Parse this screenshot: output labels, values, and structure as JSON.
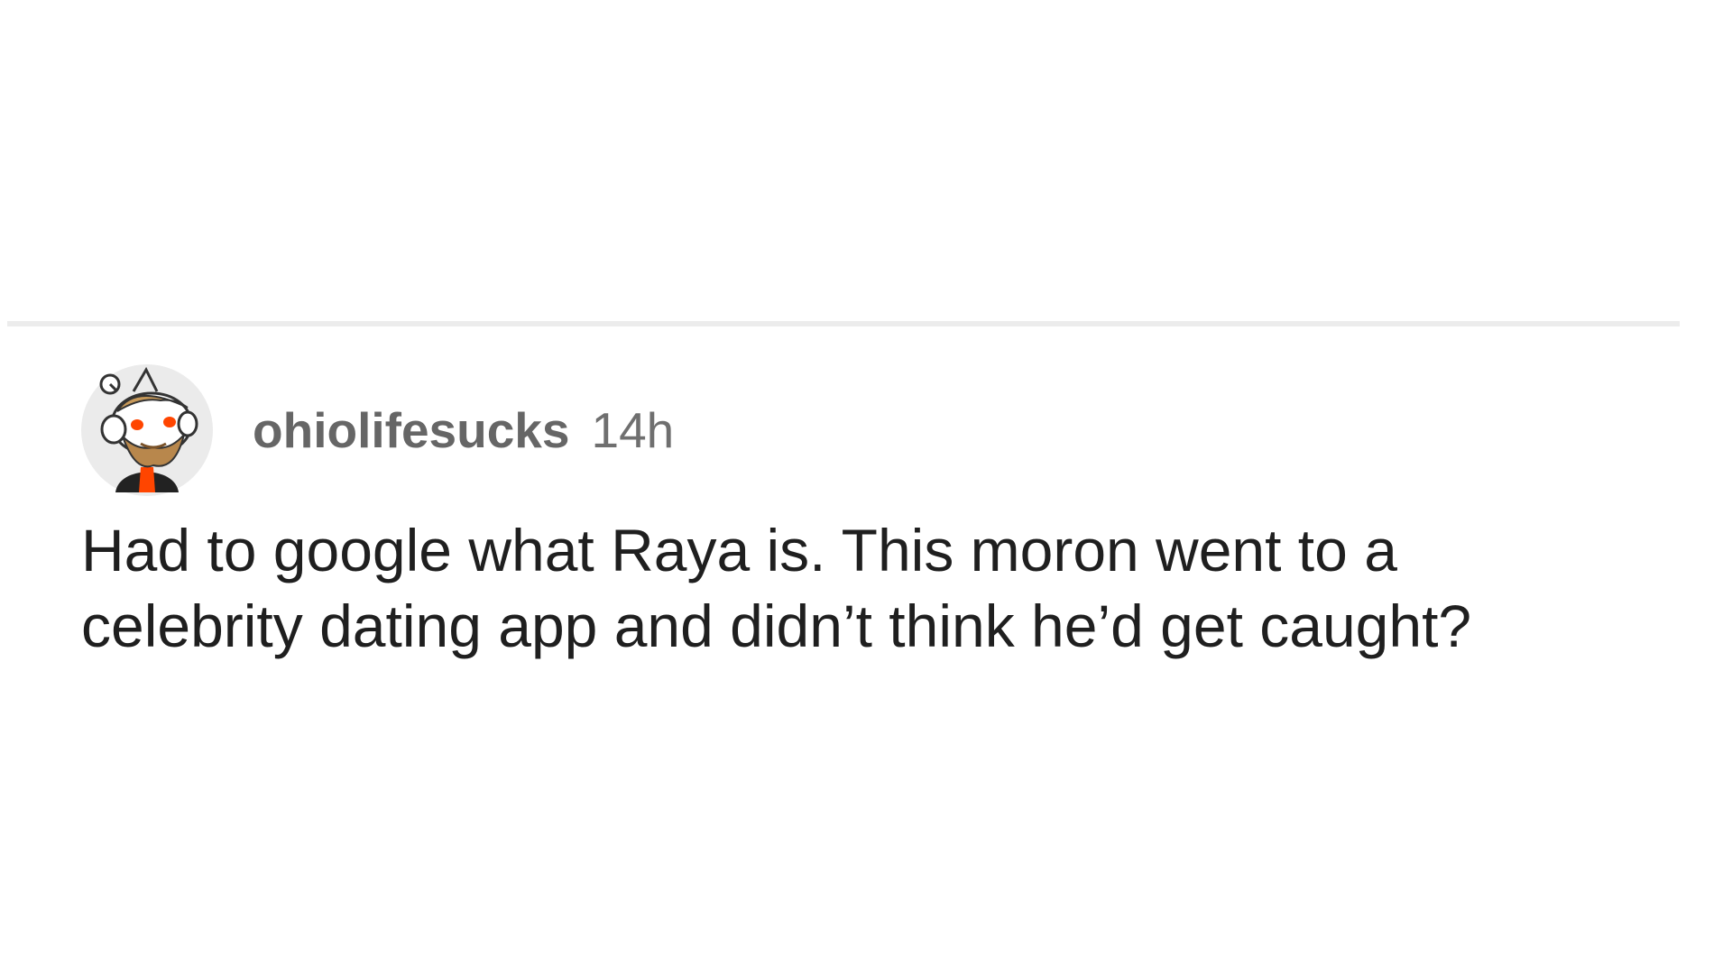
{
  "comment": {
    "avatar_icon": "snoo-avatar-icon",
    "username": "ohiolifesucks",
    "timestamp": "14h",
    "body": "Had to google what Raya is. This moron went to a celebrity dating app and didn’t think he’d get caught?"
  },
  "colors": {
    "background": "#ffffff",
    "divider": "#ececec",
    "username": "#666666",
    "body_text": "#1f1f1f",
    "avatar_bg": "#ebebeb",
    "avatar_eyes": "#ff4500"
  }
}
